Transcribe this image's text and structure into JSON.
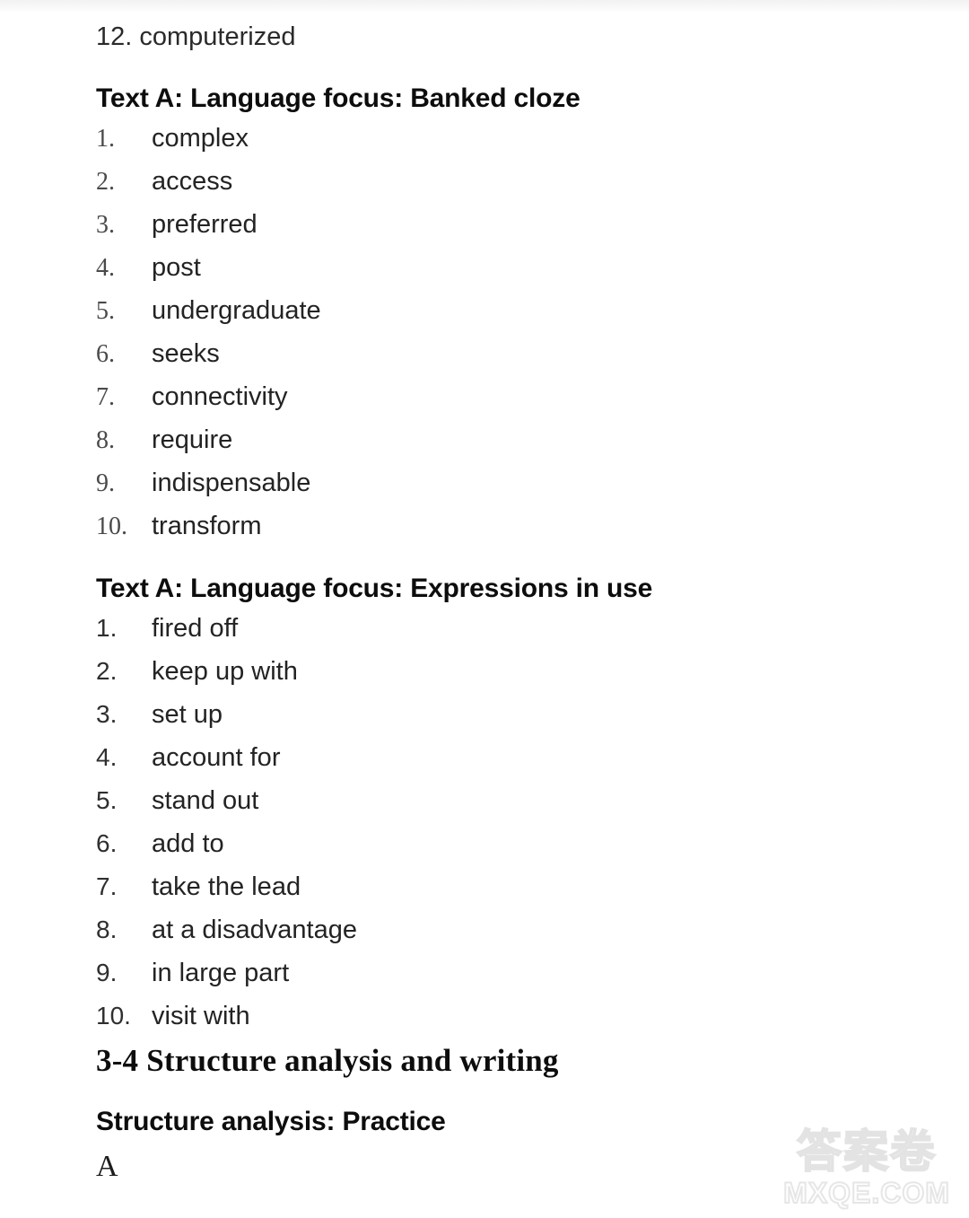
{
  "page": {
    "background_color": "#ffffff",
    "text_color": "#141414"
  },
  "top_line": {
    "text": "12. computerized",
    "number": "12.",
    "word": "computerized"
  },
  "sections": [
    {
      "heading": "Text A: Language focus: Banked cloze",
      "heading_style": "bold-sans",
      "numeral_style": "serif",
      "items": [
        {
          "num": "1.",
          "word": "complex"
        },
        {
          "num": "2.",
          "word": "access"
        },
        {
          "num": "3.",
          "word": "preferred"
        },
        {
          "num": "4.",
          "word": "post"
        },
        {
          "num": "5.",
          "word": "undergraduate"
        },
        {
          "num": "6.",
          "word": "seeks"
        },
        {
          "num": "7.",
          "word": "connectivity"
        },
        {
          "num": "8.",
          "word": "require"
        },
        {
          "num": "9.",
          "word": "indispensable"
        },
        {
          "num": "10.",
          "word": "transform"
        }
      ]
    },
    {
      "heading": "Text A: Language focus: Expressions in use",
      "heading_style": "bold-sans",
      "numeral_style": "sans",
      "items": [
        {
          "num": "1.",
          "word": "fired off"
        },
        {
          "num": "2.",
          "word": "keep up with"
        },
        {
          "num": "3.",
          "word": "set up"
        },
        {
          "num": "4.",
          "word": "account for"
        },
        {
          "num": "5.",
          "word": "stand out"
        },
        {
          "num": "6.",
          "word": "add to"
        },
        {
          "num": "7.",
          "word": "take the lead"
        },
        {
          "num": "8.",
          "word": "at a disadvantage"
        },
        {
          "num": "9.",
          "word": "in large part"
        },
        {
          "num": "10.",
          "word": "visit with"
        }
      ]
    }
  ],
  "unit_heading": {
    "text": "3-4 Structure analysis and writing",
    "style": "bold-serif"
  },
  "practice_heading": {
    "text": "Structure analysis: Practice",
    "style": "bold-sans"
  },
  "trailing_letter": "A",
  "watermark": {
    "cjk": "答案卷",
    "domain": "MXQE.COM",
    "outline_color": "#e4e4e4"
  }
}
